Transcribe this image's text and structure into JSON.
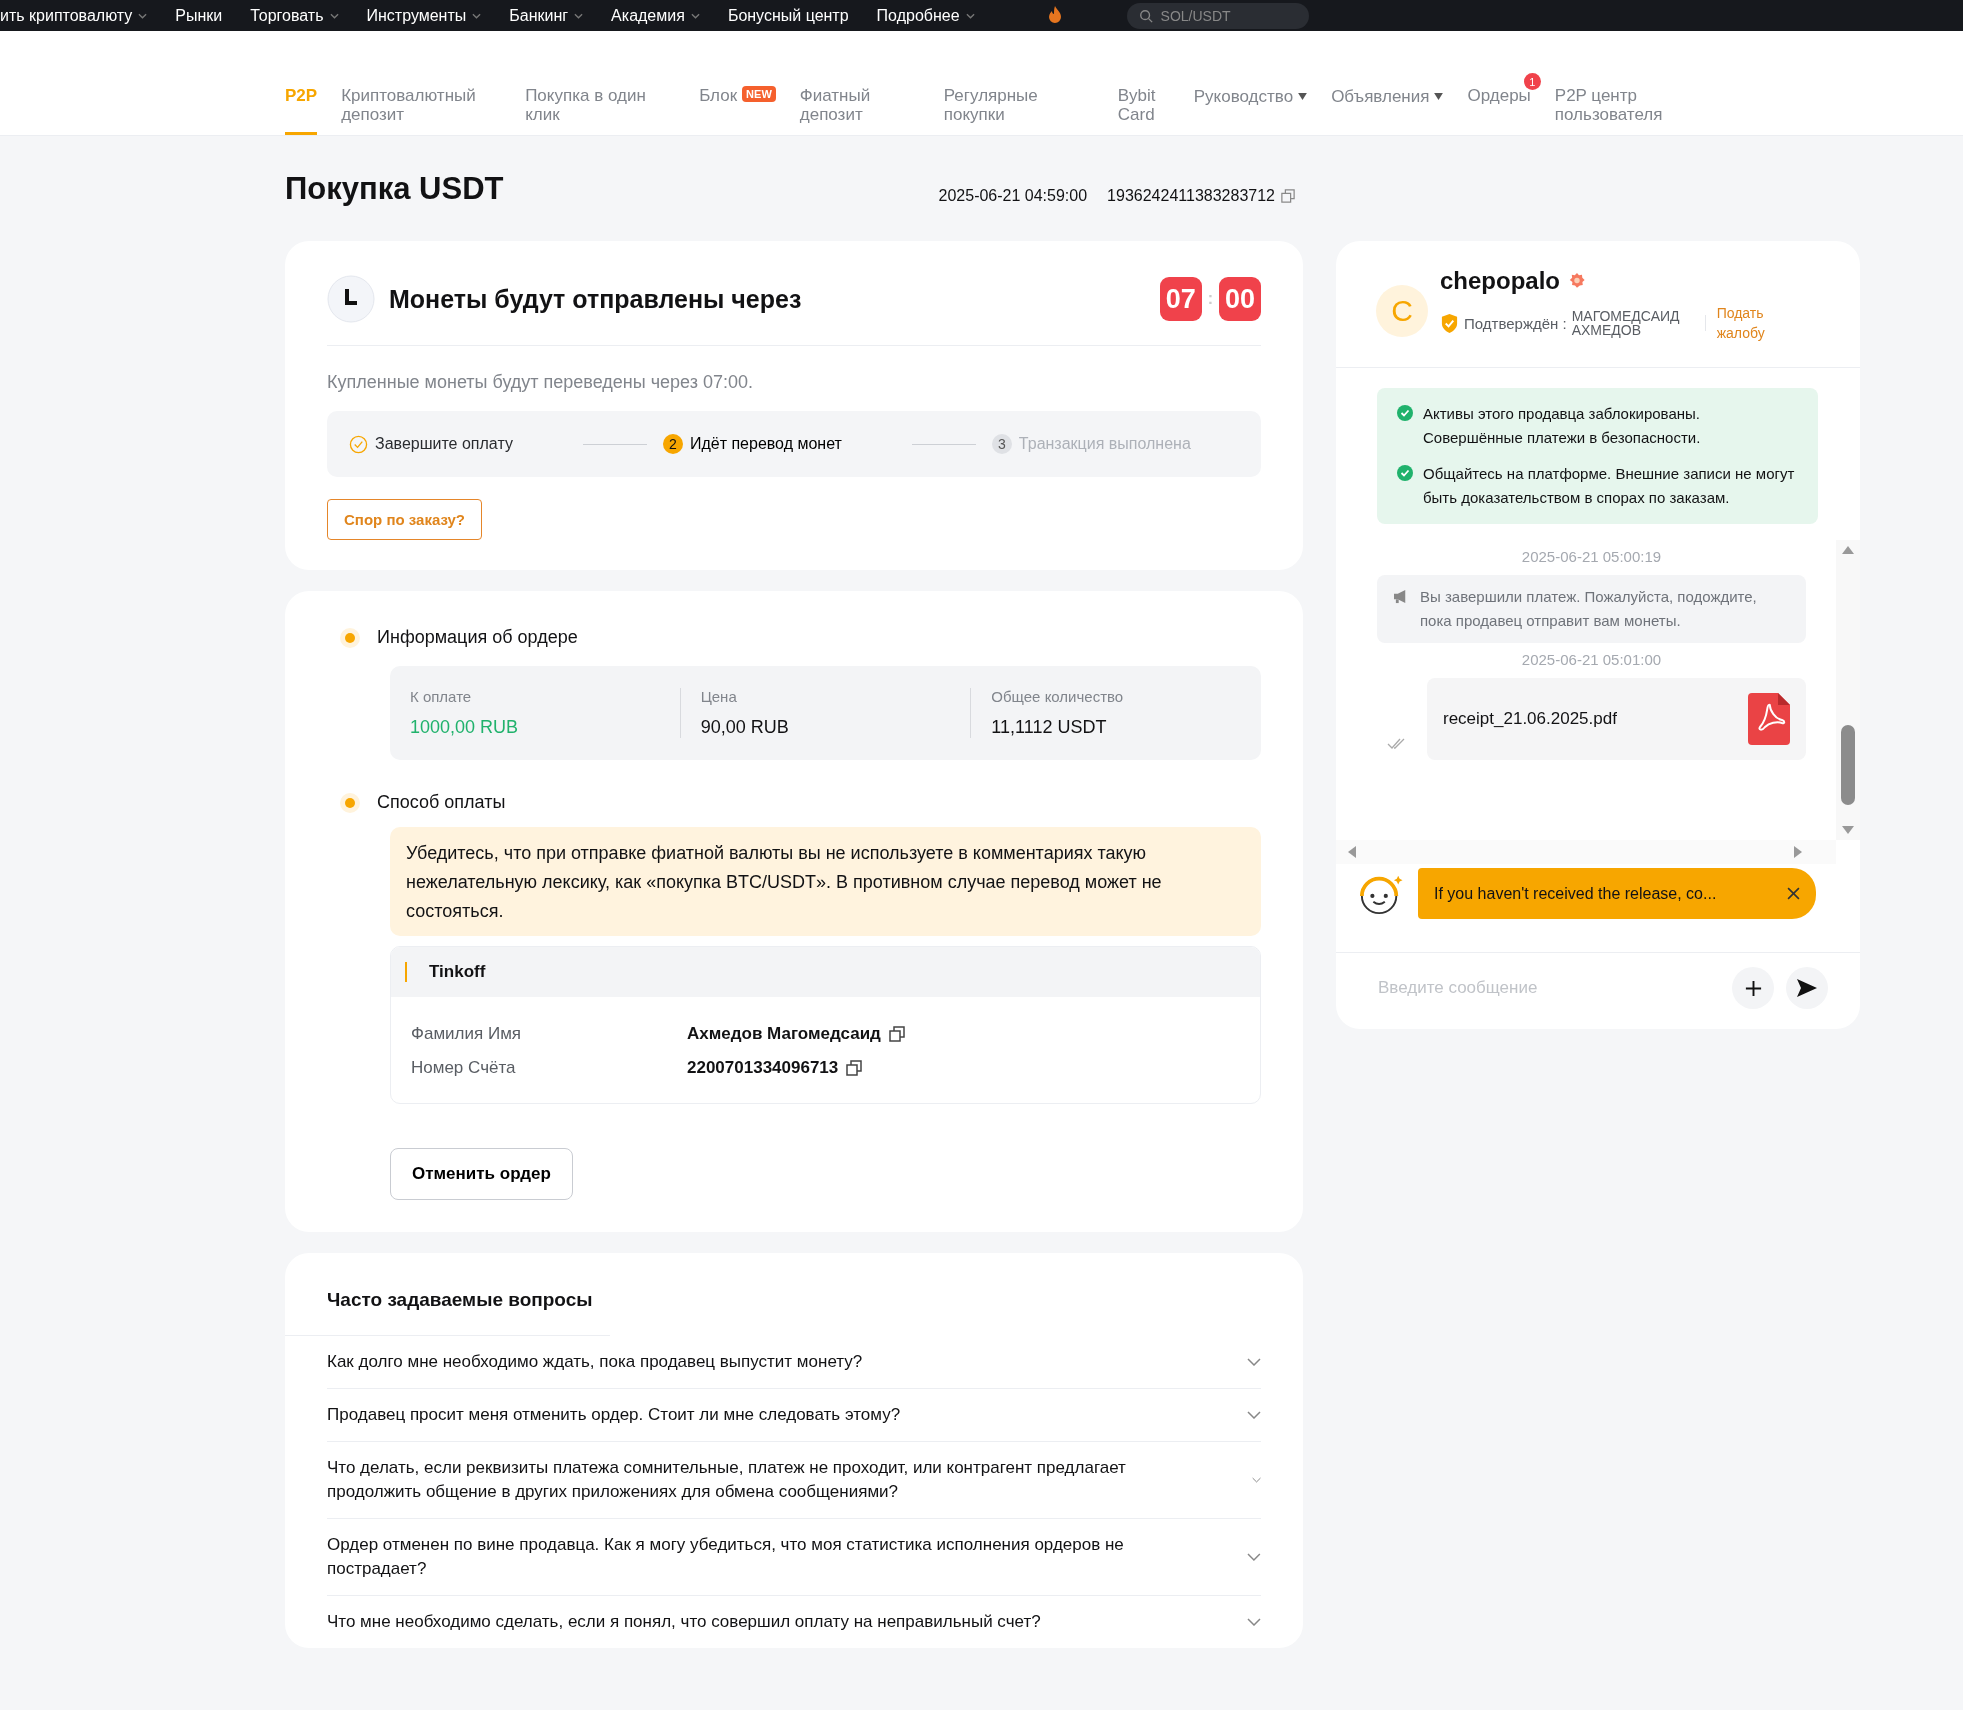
{
  "top_nav": {
    "items": [
      {
        "label": "ить криптовалюту",
        "dropdown": true
      },
      {
        "label": "Рынки",
        "dropdown": false
      },
      {
        "label": "Торговать",
        "dropdown": true
      },
      {
        "label": "Инструменты",
        "dropdown": true
      },
      {
        "label": "Банкинг",
        "dropdown": true
      },
      {
        "label": "Академия",
        "dropdown": true
      },
      {
        "label": "Бонусный центр",
        "dropdown": false
      },
      {
        "label": "Подробнее",
        "dropdown": true
      }
    ],
    "search": {
      "placeholder": "SOL/USDT"
    }
  },
  "sub_nav": [
    {
      "label": "P2P",
      "selected": true
    },
    {
      "label": "Криптовалютный депозит",
      "selected": false
    },
    {
      "label": "Покупка в один клик",
      "selected": false
    },
    {
      "label": "Блок",
      "selected": false,
      "badge": "NEW"
    },
    {
      "label": "Фиатный депозит",
      "selected": false
    },
    {
      "label": "Регулярные покупки",
      "selected": false
    },
    {
      "label": "Bybit Card",
      "selected": false
    },
    {
      "label": "Руководство",
      "selected": false,
      "dropdown": true
    },
    {
      "label": "Объявления",
      "selected": false,
      "dropdown": true
    },
    {
      "label": "Ордеры",
      "selected": false,
      "count": "1"
    },
    {
      "label": "P2P центр пользователя",
      "selected": false
    }
  ],
  "order": {
    "title": "Покупка USDT",
    "time": "2025-06-21 04:59:00",
    "id": "1936242411383283712"
  },
  "countdown": {
    "heading": "Монеты будут отправлены через",
    "minutes": "07",
    "separator": ":",
    "seconds": "00",
    "note": "Купленные монеты будут переведены через 07:00.",
    "steps": [
      {
        "label": "Завершите оплату",
        "completed": true,
        "active": false
      },
      {
        "label": "Идёт перевод монет",
        "number": "2",
        "completed": false,
        "active": true
      },
      {
        "label": "Транзакция выполнена",
        "number": "3",
        "completed": false,
        "active": false
      }
    ],
    "dispute_button": "Спор по заказу?"
  },
  "order_info": {
    "heading": "Информация об ордере",
    "fields": [
      {
        "label": "К оплате",
        "value": "1000,00 RUB",
        "highlight": true
      },
      {
        "label": "Цена",
        "value": "90,00 RUB",
        "highlight": false
      },
      {
        "label": "Общее количество",
        "value": "11,1112 USDT",
        "highlight": false
      }
    ]
  },
  "payment": {
    "heading": "Способ оплаты",
    "warning": "Убедитесь, что при отправке фиатной валюты вы не используете в комментариях такую нежелательную лексику, как «покупка BTC/USDT». В противном случае перевод может не состояться.",
    "method": "Tinkoff",
    "details": [
      {
        "label": "Фамилия Имя",
        "value": "Ахмедов Магомедсаид"
      },
      {
        "label": "Номер Счёта",
        "value": "2200701334096713"
      }
    ]
  },
  "cancel_button": "Отменить ордер",
  "faq": {
    "title": "Часто задаваемые вопросы",
    "items": [
      {
        "question": "Как долго мне необходимо ждать, пока продавец выпустит монету?",
        "expanded": false
      },
      {
        "question": "Продавец просит меня отменить ордер. Стоит ли мне следовать этому?",
        "expanded": false
      },
      {
        "question": "Что делать, если реквизиты платежа сомнительные, платеж не проходит, или контрагент предлагает продолжить общение в других приложениях для обмена сообщениями?",
        "expanded": false
      },
      {
        "question": "Ордер отменен по вине продавца. Как я могу убедиться, что моя статистика исполнения ордеров не пострадает?",
        "expanded": false
      },
      {
        "question": "Что мне необходимо сделать, если я понял, что совершил оплату на неправильный счет?",
        "expanded": false
      }
    ]
  },
  "chat": {
    "user": {
      "initial": "C",
      "name": "chepopalo",
      "verified_label": "Подтверждён :",
      "verified_name": "МАГОМЕДСАИД АХМЕДОВ",
      "complaint_link": "Подать жалобу"
    },
    "notices": [
      "Активы этого продавца заблокированы. Совершённые платежи в безопасности.",
      "Общайтесь на платформе. Внешние записи не могут быть доказательством в спорах по заказам."
    ],
    "messages": [
      {
        "kind": "system",
        "time": "2025-06-21 05:00:19",
        "text": "Вы завершили платеж. Пожалуйста, подождите, пока продавец отправит вам монеты."
      },
      {
        "kind": "file",
        "time": "2025-06-21 05:01:00",
        "filename": "receipt_21.06.2025.pdf",
        "read": true
      }
    ],
    "bot_tip": "If you haven't received the release, co...",
    "input": {
      "placeholder": "Введите сообщение"
    }
  }
}
